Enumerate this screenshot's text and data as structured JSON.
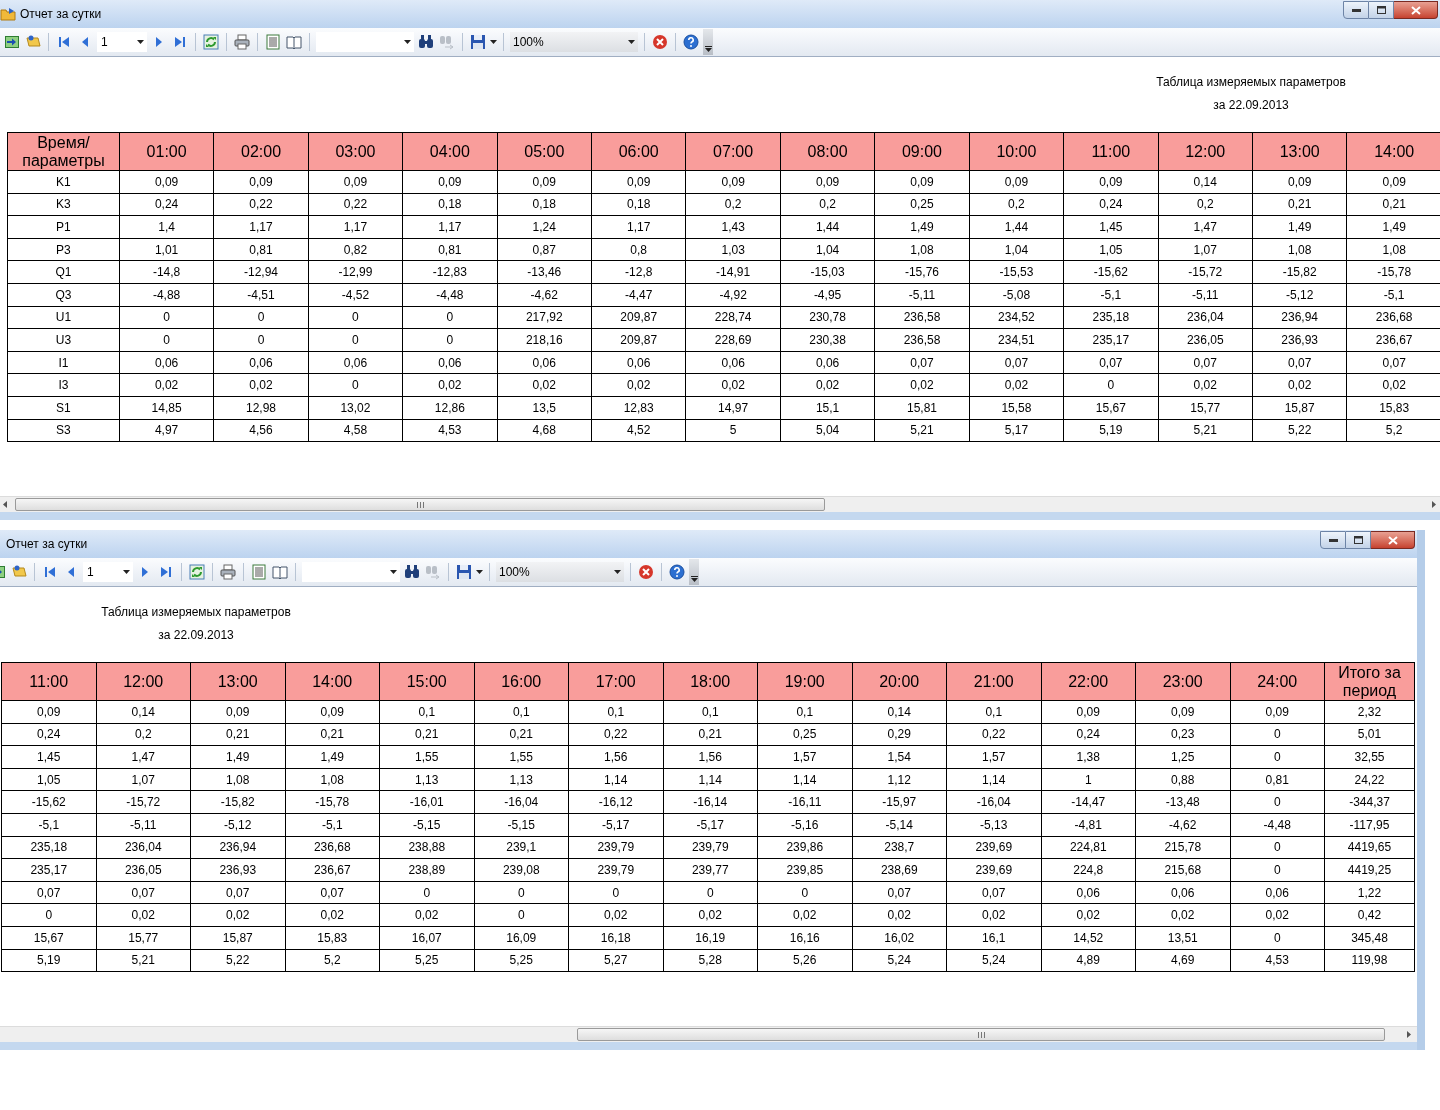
{
  "windows": [
    {
      "title": "Отчет за сутки",
      "toolbar": {
        "page": "1",
        "zoom": "100%",
        "find_next": {
          "disabled": true
        }
      },
      "report": {
        "title": "Таблица измеряемых параметров",
        "date": "за 22.09.2013"
      },
      "table": {
        "columns": [
          "Время/параметры",
          "01:00",
          "02:00",
          "03:00",
          "04:00",
          "05:00",
          "06:00",
          "07:00",
          "08:00",
          "09:00",
          "10:00",
          "11:00",
          "12:00",
          "13:00",
          "14:00"
        ],
        "rows": [
          {
            "cells": [
              "K1",
              "0,09",
              "0,09",
              "0,09",
              "0,09",
              "0,09",
              "0,09",
              "0,09",
              "0,09",
              "0,09",
              "0,09",
              "0,09",
              "0,14",
              "0,09",
              "0,09"
            ]
          },
          {
            "cells": [
              "K3",
              "0,24",
              "0,22",
              "0,22",
              "0,18",
              "0,18",
              "0,18",
              "0,2",
              "0,2",
              "0,25",
              "0,2",
              "0,24",
              "0,2",
              "0,21",
              "0,21"
            ]
          },
          {
            "cells": [
              "P1",
              "1,4",
              "1,17",
              "1,17",
              "1,17",
              "1,24",
              "1,17",
              "1,43",
              "1,44",
              "1,49",
              "1,44",
              "1,45",
              "1,47",
              "1,49",
              "1,49"
            ]
          },
          {
            "cells": [
              "P3",
              "1,01",
              "0,81",
              "0,82",
              "0,81",
              "0,87",
              "0,8",
              "1,03",
              "1,04",
              "1,08",
              "1,04",
              "1,05",
              "1,07",
              "1,08",
              "1,08"
            ]
          },
          {
            "cells": [
              "Q1",
              "-14,8",
              "-12,94",
              "-12,99",
              "-12,83",
              "-13,46",
              "-12,8",
              "-14,91",
              "-15,03",
              "-15,76",
              "-15,53",
              "-15,62",
              "-15,72",
              "-15,82",
              "-15,78"
            ]
          },
          {
            "cells": [
              "Q3",
              "-4,88",
              "-4,51",
              "-4,52",
              "-4,48",
              "-4,62",
              "-4,47",
              "-4,92",
              "-4,95",
              "-5,11",
              "-5,08",
              "-5,1",
              "-5,11",
              "-5,12",
              "-5,1"
            ]
          },
          {
            "cells": [
              "U1",
              "0",
              "0",
              "0",
              "0",
              "217,92",
              "209,87",
              "228,74",
              "230,78",
              "236,58",
              "234,52",
              "235,18",
              "236,04",
              "236,94",
              "236,68"
            ]
          },
          {
            "cells": [
              "U3",
              "0",
              "0",
              "0",
              "0",
              "218,16",
              "209,87",
              "228,69",
              "230,38",
              "236,58",
              "234,51",
              "235,17",
              "236,05",
              "236,93",
              "236,67"
            ]
          },
          {
            "cells": [
              "I1",
              "0,06",
              "0,06",
              "0,06",
              "0,06",
              "0,06",
              "0,06",
              "0,06",
              "0,06",
              "0,07",
              "0,07",
              "0,07",
              "0,07",
              "0,07",
              "0,07"
            ]
          },
          {
            "cells": [
              "I3",
              "0,02",
              "0,02",
              "0",
              "0,02",
              "0,02",
              "0,02",
              "0,02",
              "0,02",
              "0,02",
              "0,02",
              "0",
              "0,02",
              "0,02",
              "0,02"
            ]
          },
          {
            "cells": [
              "S1",
              "14,85",
              "12,98",
              "13,02",
              "12,86",
              "13,5",
              "12,83",
              "14,97",
              "15,1",
              "15,81",
              "15,58",
              "15,67",
              "15,77",
              "15,87",
              "15,83"
            ]
          },
          {
            "cells": [
              "S3",
              "4,97",
              "4,56",
              "4,58",
              "4,53",
              "4,68",
              "4,52",
              "5",
              "5,04",
              "5,21",
              "5,17",
              "5,19",
              "5,21",
              "5,22",
              "5,2"
            ]
          }
        ]
      }
    },
    {
      "title": "Отчет за сутки",
      "toolbar": {
        "page": "1",
        "zoom": "100%",
        "find_next": {
          "disabled": true
        }
      },
      "report": {
        "title": "Таблица измеряемых параметров",
        "date": "за 22.09.2013"
      },
      "table": {
        "columns": [
          "11:00",
          "12:00",
          "13:00",
          "14:00",
          "15:00",
          "16:00",
          "17:00",
          "18:00",
          "19:00",
          "20:00",
          "21:00",
          "22:00",
          "23:00",
          "24:00",
          "Итого за период"
        ],
        "rows": [
          {
            "cells": [
              "0,09",
              "0,14",
              "0,09",
              "0,09",
              "0,1",
              "0,1",
              "0,1",
              "0,1",
              "0,1",
              "0,14",
              "0,1",
              "0,09",
              "0,09",
              "0,09",
              "2,32"
            ]
          },
          {
            "cells": [
              "0,24",
              "0,2",
              "0,21",
              "0,21",
              "0,21",
              "0,21",
              "0,22",
              "0,21",
              "0,25",
              "0,29",
              "0,22",
              "0,24",
              "0,23",
              "0",
              "5,01"
            ]
          },
          {
            "cells": [
              "1,45",
              "1,47",
              "1,49",
              "1,49",
              "1,55",
              "1,55",
              "1,56",
              "1,56",
              "1,57",
              "1,54",
              "1,57",
              "1,38",
              "1,25",
              "0",
              "32,55"
            ]
          },
          {
            "cells": [
              "1,05",
              "1,07",
              "1,08",
              "1,08",
              "1,13",
              "1,13",
              "1,14",
              "1,14",
              "1,14",
              "1,12",
              "1,14",
              "1",
              "0,88",
              "0,81",
              "24,22"
            ]
          },
          {
            "cells": [
              "-15,62",
              "-15,72",
              "-15,82",
              "-15,78",
              "-16,01",
              "-16,04",
              "-16,12",
              "-16,14",
              "-16,11",
              "-15,97",
              "-16,04",
              "-14,47",
              "-13,48",
              "0",
              "-344,37"
            ]
          },
          {
            "cells": [
              "-5,1",
              "-5,11",
              "-5,12",
              "-5,1",
              "-5,15",
              "-5,15",
              "-5,17",
              "-5,17",
              "-5,16",
              "-5,14",
              "-5,13",
              "-4,81",
              "-4,62",
              "-4,48",
              "-117,95"
            ]
          },
          {
            "cells": [
              "235,18",
              "236,04",
              "236,94",
              "236,68",
              "238,88",
              "239,1",
              "239,79",
              "239,79",
              "239,86",
              "238,7",
              "239,69",
              "224,81",
              "215,78",
              "0",
              "4419,65"
            ]
          },
          {
            "cells": [
              "235,17",
              "236,05",
              "236,93",
              "236,67",
              "238,89",
              "239,08",
              "239,79",
              "239,77",
              "239,85",
              "238,69",
              "239,69",
              "224,8",
              "215,68",
              "0",
              "4419,25"
            ]
          },
          {
            "cells": [
              "0,07",
              "0,07",
              "0,07",
              "0,07",
              "0",
              "0",
              "0",
              "0",
              "0",
              "0,07",
              "0,07",
              "0,06",
              "0,06",
              "0,06",
              "1,22"
            ]
          },
          {
            "cells": [
              "0",
              "0,02",
              "0,02",
              "0,02",
              "0,02",
              "0",
              "0,02",
              "0,02",
              "0,02",
              "0,02",
              "0,02",
              "0,02",
              "0,02",
              "0,02",
              "0,42"
            ]
          },
          {
            "cells": [
              "15,67",
              "15,77",
              "15,87",
              "15,83",
              "16,07",
              "16,09",
              "16,18",
              "16,19",
              "16,16",
              "16,02",
              "16,1",
              "14,52",
              "13,51",
              "0",
              "345,48"
            ]
          },
          {
            "cells": [
              "5,19",
              "5,21",
              "5,22",
              "5,2",
              "5,25",
              "5,25",
              "5,27",
              "5,28",
              "5,26",
              "5,24",
              "5,24",
              "4,89",
              "4,69",
              "4,53",
              "119,98"
            ]
          }
        ]
      }
    }
  ]
}
